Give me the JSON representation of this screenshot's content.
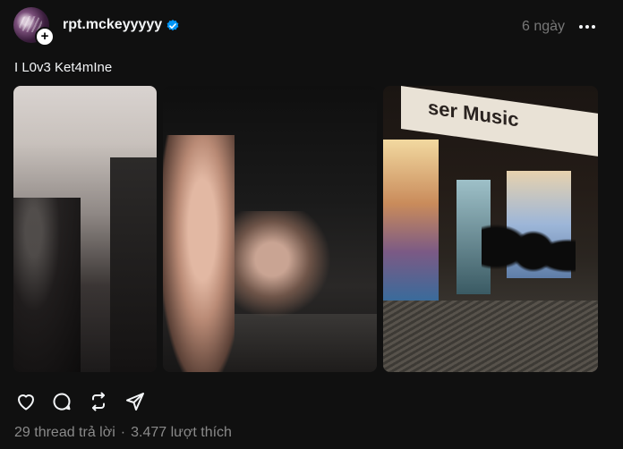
{
  "post": {
    "username": "rpt.mckeyyyyy",
    "verified": true,
    "timestamp": "6 ngày",
    "caption": "I L0v3 Ket4mIne"
  },
  "media": {
    "store_sign_text": "ser Music"
  },
  "stats": {
    "replies": "29 thread trả lời",
    "separator": "·",
    "likes": "3.477 lượt thích"
  },
  "icons": {
    "like": "heart-icon",
    "reply": "comment-icon",
    "repost": "repost-icon",
    "share": "send-icon",
    "more": "more-icon",
    "verified": "verified-badge-icon"
  },
  "colors": {
    "background": "#101010",
    "text": "#f3f5f7",
    "muted": "#777777",
    "verified": "#0095f6"
  }
}
